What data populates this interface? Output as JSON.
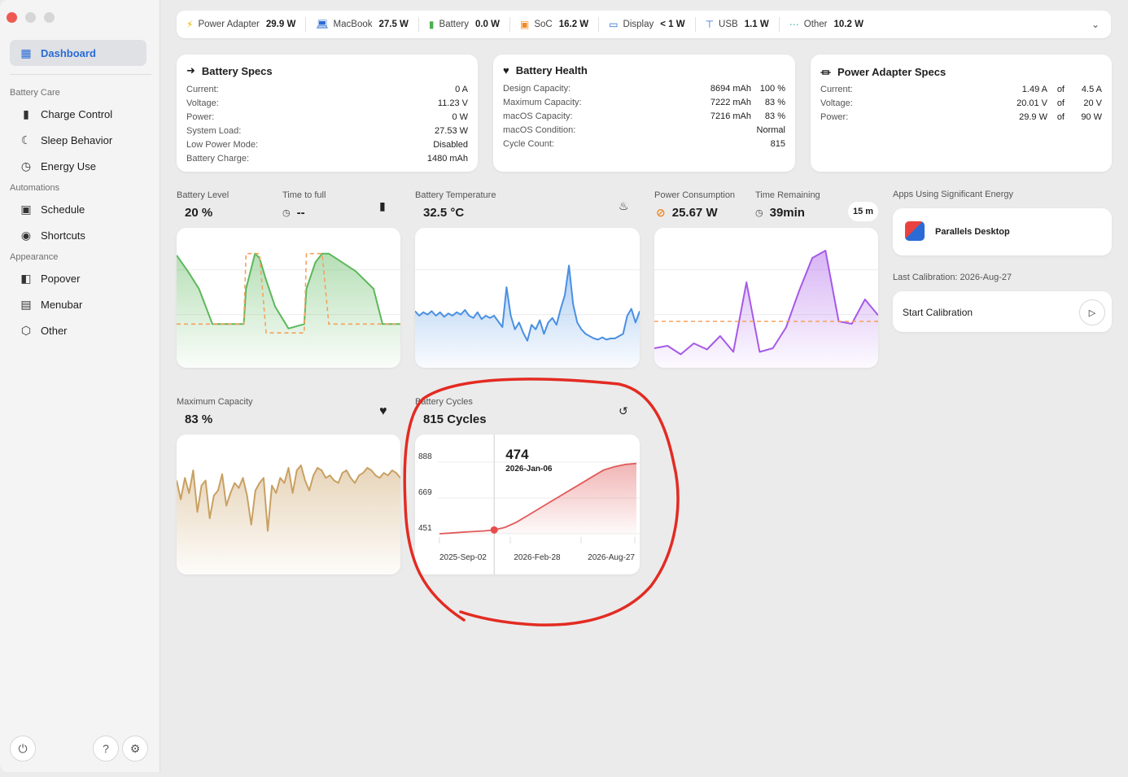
{
  "sidebar": {
    "dashboard": "Dashboard",
    "sections": {
      "battery_care": "Battery Care",
      "automations": "Automations",
      "appearance": "Appearance"
    },
    "items": {
      "charge_control": "Charge Control",
      "sleep_behavior": "Sleep Behavior",
      "energy_use": "Energy Use",
      "schedule": "Schedule",
      "shortcuts": "Shortcuts",
      "popover": "Popover",
      "menubar": "Menubar",
      "other": "Other"
    },
    "bottom": {
      "power_icon": "power-icon",
      "help_icon": "help-icon",
      "settings_icon": "gear-icon"
    }
  },
  "topbar": {
    "power_adapter": {
      "label": "Power Adapter",
      "value": "29.9 W"
    },
    "macbook": {
      "label": "MacBook",
      "value": "27.5 W"
    },
    "battery": {
      "label": "Battery",
      "value": "0.0 W"
    },
    "soc": {
      "label": "SoC",
      "value": "16.2 W"
    },
    "display": {
      "label": "Display",
      "value": "< 1 W"
    },
    "usb": {
      "label": "USB",
      "value": "1.1 W"
    },
    "other": {
      "label": "Other",
      "value": "10.2 W"
    }
  },
  "battery_specs": {
    "title": "Battery Specs",
    "rows": [
      {
        "label": "Current:",
        "value": "0 A"
      },
      {
        "label": "Voltage:",
        "value": "11.23 V"
      },
      {
        "label": "Power:",
        "value": "0 W"
      },
      {
        "label": "System Load:",
        "value": "27.53 W"
      },
      {
        "label": "Low Power Mode:",
        "value": "Disabled"
      },
      {
        "label": "Battery Charge:",
        "value": "1480 mAh"
      }
    ]
  },
  "battery_health": {
    "title": "Battery Health",
    "rows": [
      {
        "label": "Design Capacity:",
        "value": "8694 mAh",
        "pct": "100 %"
      },
      {
        "label": "Maximum Capacity:",
        "value": "7222 mAh",
        "pct": "83 %"
      },
      {
        "label": "macOS Capacity:",
        "value": "7216 mAh",
        "pct": "83 %"
      },
      {
        "label": "macOS Condition:",
        "value": "Normal",
        "pct": ""
      },
      {
        "label": "Cycle Count:",
        "value": "815",
        "pct": ""
      }
    ]
  },
  "adapter_specs": {
    "title": "Power Adapter Specs",
    "rows": [
      {
        "label": "Current:",
        "value": "1.49 A",
        "of": "of",
        "max": "4.5 A"
      },
      {
        "label": "Voltage:",
        "value": "20.01 V",
        "of": "of",
        "max": "20 V"
      },
      {
        "label": "Power:",
        "value": "29.9 W",
        "of": "of",
        "max": "90 W"
      }
    ]
  },
  "metrics": {
    "battery_level": {
      "label": "Battery Level",
      "value": "20 %"
    },
    "time_to_full": {
      "label": "Time to full",
      "value": "--"
    },
    "battery_temp": {
      "label": "Battery Temperature",
      "value": "32.5 °C"
    },
    "power_consumption": {
      "label": "Power Consumption",
      "value": "25.67 W"
    },
    "time_remaining": {
      "label": "Time Remaining",
      "value": "39min",
      "badge": "15 m"
    },
    "max_capacity": {
      "label": "Maximum Capacity",
      "value": "83 %"
    },
    "battery_cycles": {
      "label": "Battery Cycles",
      "value": "815 Cycles"
    }
  },
  "apps": {
    "label": "Apps Using Significant Energy",
    "items": [
      {
        "name": "Parallels Desktop"
      }
    ]
  },
  "calibration": {
    "last_label": "Last Calibration: 2026-Aug-27",
    "button": "Start Calibration"
  },
  "chart_data": [
    {
      "type": "area",
      "name": "battery-level",
      "x": [
        0,
        5,
        10,
        16,
        22,
        30,
        31,
        35,
        37,
        40,
        44,
        50,
        57,
        58,
        62,
        65,
        68,
        80,
        88,
        92,
        100
      ],
      "values": [
        98,
        80,
        60,
        20,
        20,
        20,
        60,
        100,
        95,
        70,
        40,
        15,
        20,
        60,
        90,
        100,
        100,
        80,
        60,
        20,
        20
      ],
      "target": [
        20,
        20,
        20,
        20,
        20,
        20,
        100,
        100,
        100,
        10,
        10,
        10,
        10,
        100,
        100,
        100,
        20,
        20,
        20,
        20,
        20
      ],
      "ylim": [
        0,
        120
      ],
      "colors": {
        "line": "#5cb85c",
        "target": "#f5a15e"
      }
    },
    {
      "type": "area",
      "name": "battery-temperature",
      "values": [
        34,
        30,
        33,
        31,
        34,
        30,
        33,
        29,
        32,
        30,
        33,
        31,
        35,
        30,
        28,
        33,
        27,
        30,
        28,
        30,
        25,
        20,
        55,
        30,
        18,
        24,
        15,
        8,
        22,
        18,
        26,
        14,
        24,
        28,
        22,
        36,
        48,
        74,
        40,
        24,
        18,
        14,
        12,
        10,
        9,
        11,
        9,
        10,
        10,
        12,
        14,
        30,
        36,
        24,
        34
      ],
      "ylim": [
        0,
        100
      ],
      "colors": {
        "line": "#4a90e2"
      }
    },
    {
      "type": "area",
      "name": "power-consumption",
      "values": [
        8,
        10,
        3,
        12,
        7,
        18,
        5,
        62,
        5,
        8,
        25,
        55,
        82,
        88,
        30,
        28,
        48,
        35
      ],
      "threshold": 30,
      "ylim": [
        0,
        100
      ],
      "colors": {
        "line": "#a659e8",
        "threshold": "#f5a15e"
      }
    },
    {
      "type": "area",
      "name": "maximum-capacity",
      "values": [
        70,
        55,
        72,
        60,
        78,
        45,
        66,
        70,
        40,
        58,
        62,
        75,
        50,
        60,
        68,
        64,
        72,
        58,
        35,
        62,
        68,
        72,
        30,
        66,
        60,
        72,
        68,
        80,
        60,
        78,
        82,
        70,
        62,
        74,
        80,
        78,
        72,
        74,
        70,
        68,
        76,
        78,
        72,
        68,
        74,
        76,
        80,
        78,
        74,
        72,
        76,
        74,
        78,
        76,
        72
      ],
      "ylim": [
        0,
        100
      ],
      "colors": {
        "line": "#c9a062"
      }
    },
    {
      "type": "area",
      "title": "Battery Cycles",
      "x": [
        "2025-Sep-02",
        "2026-Feb-28",
        "2026-Aug-27"
      ],
      "values": [
        451,
        455,
        460,
        464,
        468,
        474,
        490,
        520,
        560,
        600,
        640,
        680,
        720,
        760,
        800,
        840,
        860,
        874,
        880
      ],
      "yticks": [
        451,
        669,
        888
      ],
      "ylim": [
        451,
        888
      ],
      "tooltip": {
        "value": "474",
        "date": "2026-Jan-06"
      },
      "colors": {
        "line": "#e05a5a"
      }
    }
  ]
}
